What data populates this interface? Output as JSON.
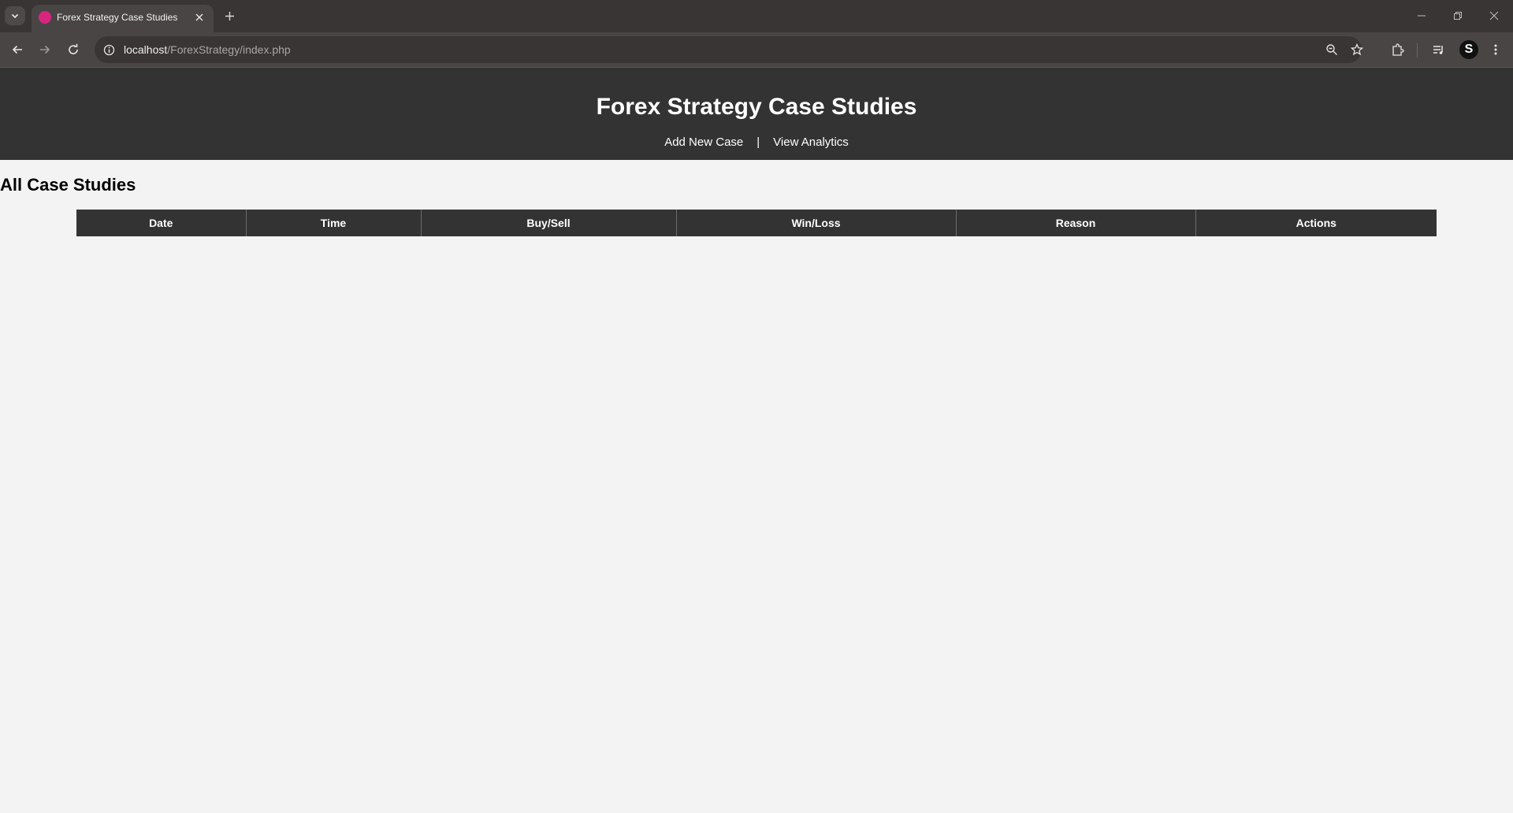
{
  "browser": {
    "tab_title": "Forex Strategy Case Studies",
    "url_host": "localhost",
    "url_path": "/ForexStrategy/index.php",
    "favicon_color": "#d9257f",
    "icons": {
      "tab_search": "chevron-down-icon",
      "tab_close": "close-icon",
      "new_tab": "plus-icon",
      "minimize": "minimize-icon",
      "restore": "restore-icon",
      "close_window": "close-icon",
      "back": "arrow-left-icon",
      "forward": "arrow-right-icon",
      "reload": "reload-icon",
      "site_info": "info-icon",
      "zoom": "zoom-icon",
      "bookmark": "star-icon",
      "extensions": "puzzle-icon",
      "media": "media-control-icon",
      "menu": "kebab-menu-icon"
    },
    "profile_initial": "S"
  },
  "header": {
    "title": "Forex Strategy Case Studies",
    "nav": {
      "add_new_case": "Add New Case",
      "separator": "|",
      "view_analytics": "View Analytics"
    },
    "background_color": "#333333"
  },
  "main": {
    "section_title": "All Case Studies",
    "table": {
      "columns": [
        "Date",
        "Time",
        "Buy/Sell",
        "Win/Loss",
        "Reason",
        "Actions"
      ],
      "rows": []
    },
    "background_color": "#f3f3f3"
  }
}
